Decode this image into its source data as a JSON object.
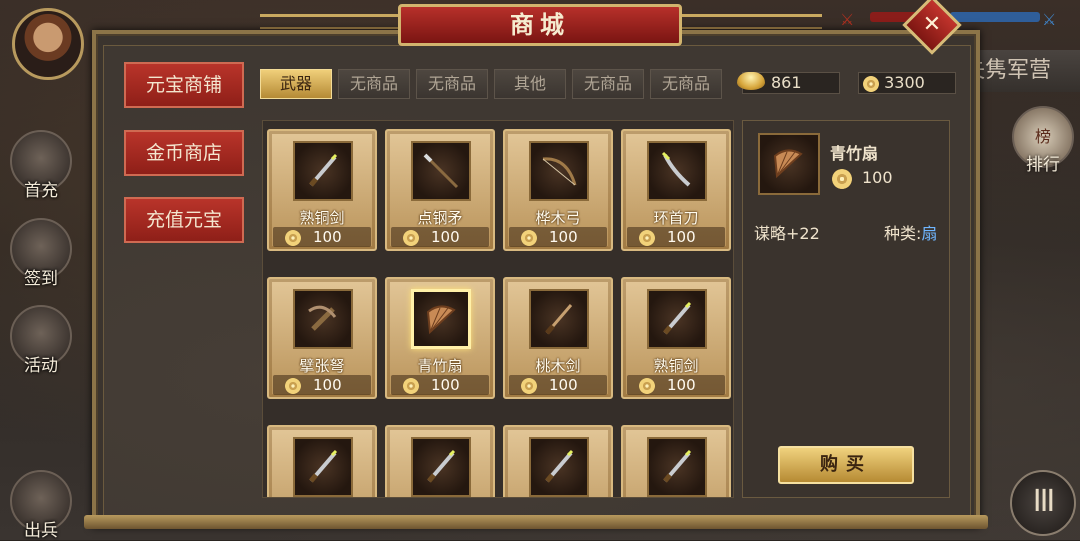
{
  "shop": {
    "title": "商城",
    "close_label": "✕"
  },
  "hud": {
    "banner_text": "失隽军营",
    "left_buttons": [
      {
        "label": "首充"
      },
      {
        "label": "签到"
      },
      {
        "label": "活动"
      },
      {
        "label": "出兵"
      }
    ],
    "rank_label": "排行",
    "rank_icon_char": "榜",
    "menu_glyph": "III"
  },
  "categories": [
    {
      "label": "元宝商铺"
    },
    {
      "label": "金币商店"
    },
    {
      "label": "充值元宝"
    }
  ],
  "tabs": [
    {
      "label": "武器",
      "active": true
    },
    {
      "label": "无商品"
    },
    {
      "label": "无商品"
    },
    {
      "label": "其他"
    },
    {
      "label": "无商品"
    },
    {
      "label": "无商品"
    }
  ],
  "currency": {
    "ingot_amount": "861",
    "coin_amount": "3300"
  },
  "items": [
    {
      "name": "熟铜剑",
      "price": "100",
      "icon": "sword-icon"
    },
    {
      "name": "点钢矛",
      "price": "100",
      "icon": "spear-icon"
    },
    {
      "name": "桦木弓",
      "price": "100",
      "icon": "bow-icon"
    },
    {
      "name": "环首刀",
      "price": "100",
      "icon": "saber-icon"
    },
    {
      "name": "擘张弩",
      "price": "100",
      "icon": "crossbow-icon"
    },
    {
      "name": "青竹扇",
      "price": "100",
      "icon": "fan-icon",
      "selected": true
    },
    {
      "name": "桃木剑",
      "price": "100",
      "icon": "wooden-sword-icon"
    },
    {
      "name": "熟铜剑",
      "price": "100",
      "icon": "sword-icon"
    },
    {
      "name": "",
      "price": "",
      "icon": "sword-icon"
    },
    {
      "name": "",
      "price": "",
      "icon": "sword-icon"
    },
    {
      "name": "",
      "price": "",
      "icon": "sword-icon"
    },
    {
      "name": "",
      "price": "",
      "icon": "sword-icon"
    }
  ],
  "detail": {
    "name": "青竹扇",
    "price": "100",
    "stat": "谋略+22",
    "type_label": "种类:",
    "type_value": "扇",
    "buy_label": "购买"
  },
  "colors": {
    "accent_gold": "#d2b46e",
    "category_red": "#b9342a",
    "type_value_blue": "#6fb6ff"
  }
}
